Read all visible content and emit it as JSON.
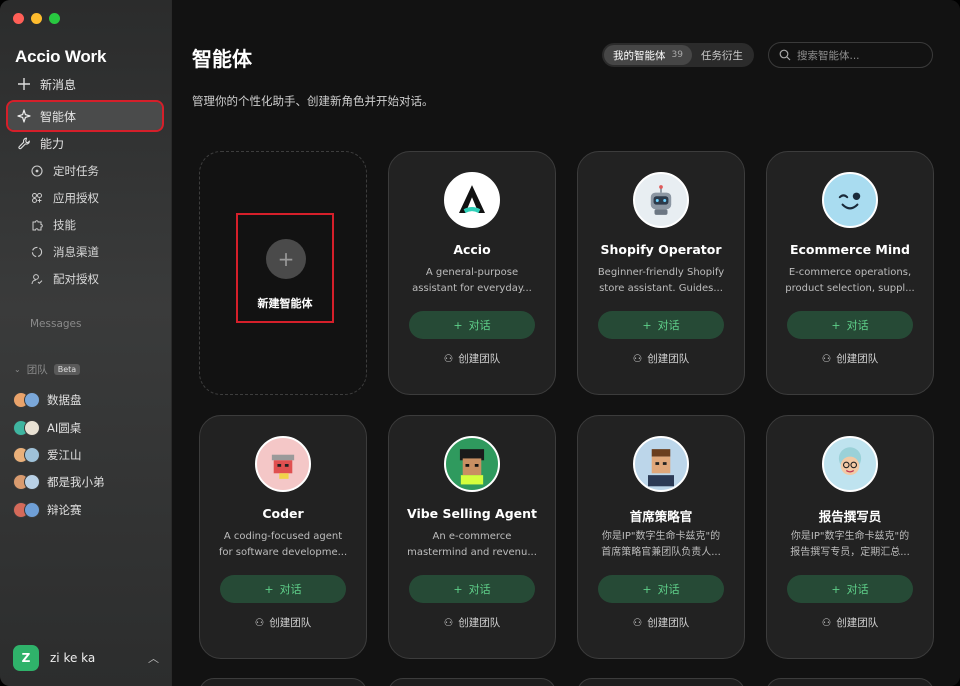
{
  "brand": "Accio Work",
  "sidebar": {
    "new_message": "新消息",
    "agents": "智能体",
    "abilities": "能力",
    "sub": [
      "定时任务",
      "应用授权",
      "技能",
      "消息渠道",
      "配对授权"
    ],
    "messages_label": "Messages",
    "team_label": "团队",
    "beta": "Beta",
    "teams": [
      "数据盘",
      "AI圆桌",
      "爱江山",
      "都是我小弟",
      "辩论赛"
    ],
    "user_initial": "Z",
    "user_name": "zi ke ka"
  },
  "header": {
    "title": "智能体",
    "description": "管理你的个性化助手、创建新角色并开始对话。",
    "tab_mine": "我的智能体",
    "tab_mine_count": "39",
    "tab_derived": "任务衍生",
    "search_placeholder": "搜索智能体..."
  },
  "new_agent_label": "新建智能体",
  "chat_label": "对话",
  "team_label": "创建团队",
  "agents": [
    {
      "name": "Accio",
      "desc1": "A general-purpose",
      "desc2": "assistant for everyday..."
    },
    {
      "name": "Shopify Operator",
      "desc1": "Beginner-friendly Shopify",
      "desc2": "store assistant. Guides..."
    },
    {
      "name": "Ecommerce Mind",
      "desc1": "E-commerce operations,",
      "desc2": "product selection, suppl..."
    },
    {
      "name": "Coder",
      "desc1": "A coding-focused agent",
      "desc2": "for software developme..."
    },
    {
      "name": "Vibe Selling Agent",
      "desc1": "An e-commerce",
      "desc2": "mastermind and revenu..."
    },
    {
      "name": "首席策略官",
      "desc1": "你是IP\"数字生命卡兹克\"的",
      "desc2": "首席策略官兼团队负责人..."
    },
    {
      "name": "报告撰写员",
      "desc1": "你是IP\"数字生命卡兹克\"的",
      "desc2": "报告撰写专员，定期汇总..."
    }
  ],
  "colors": {
    "accent_green": "#5fd08a",
    "highlight_red": "#d51f2a",
    "user_avatar": "#2fb26a"
  }
}
